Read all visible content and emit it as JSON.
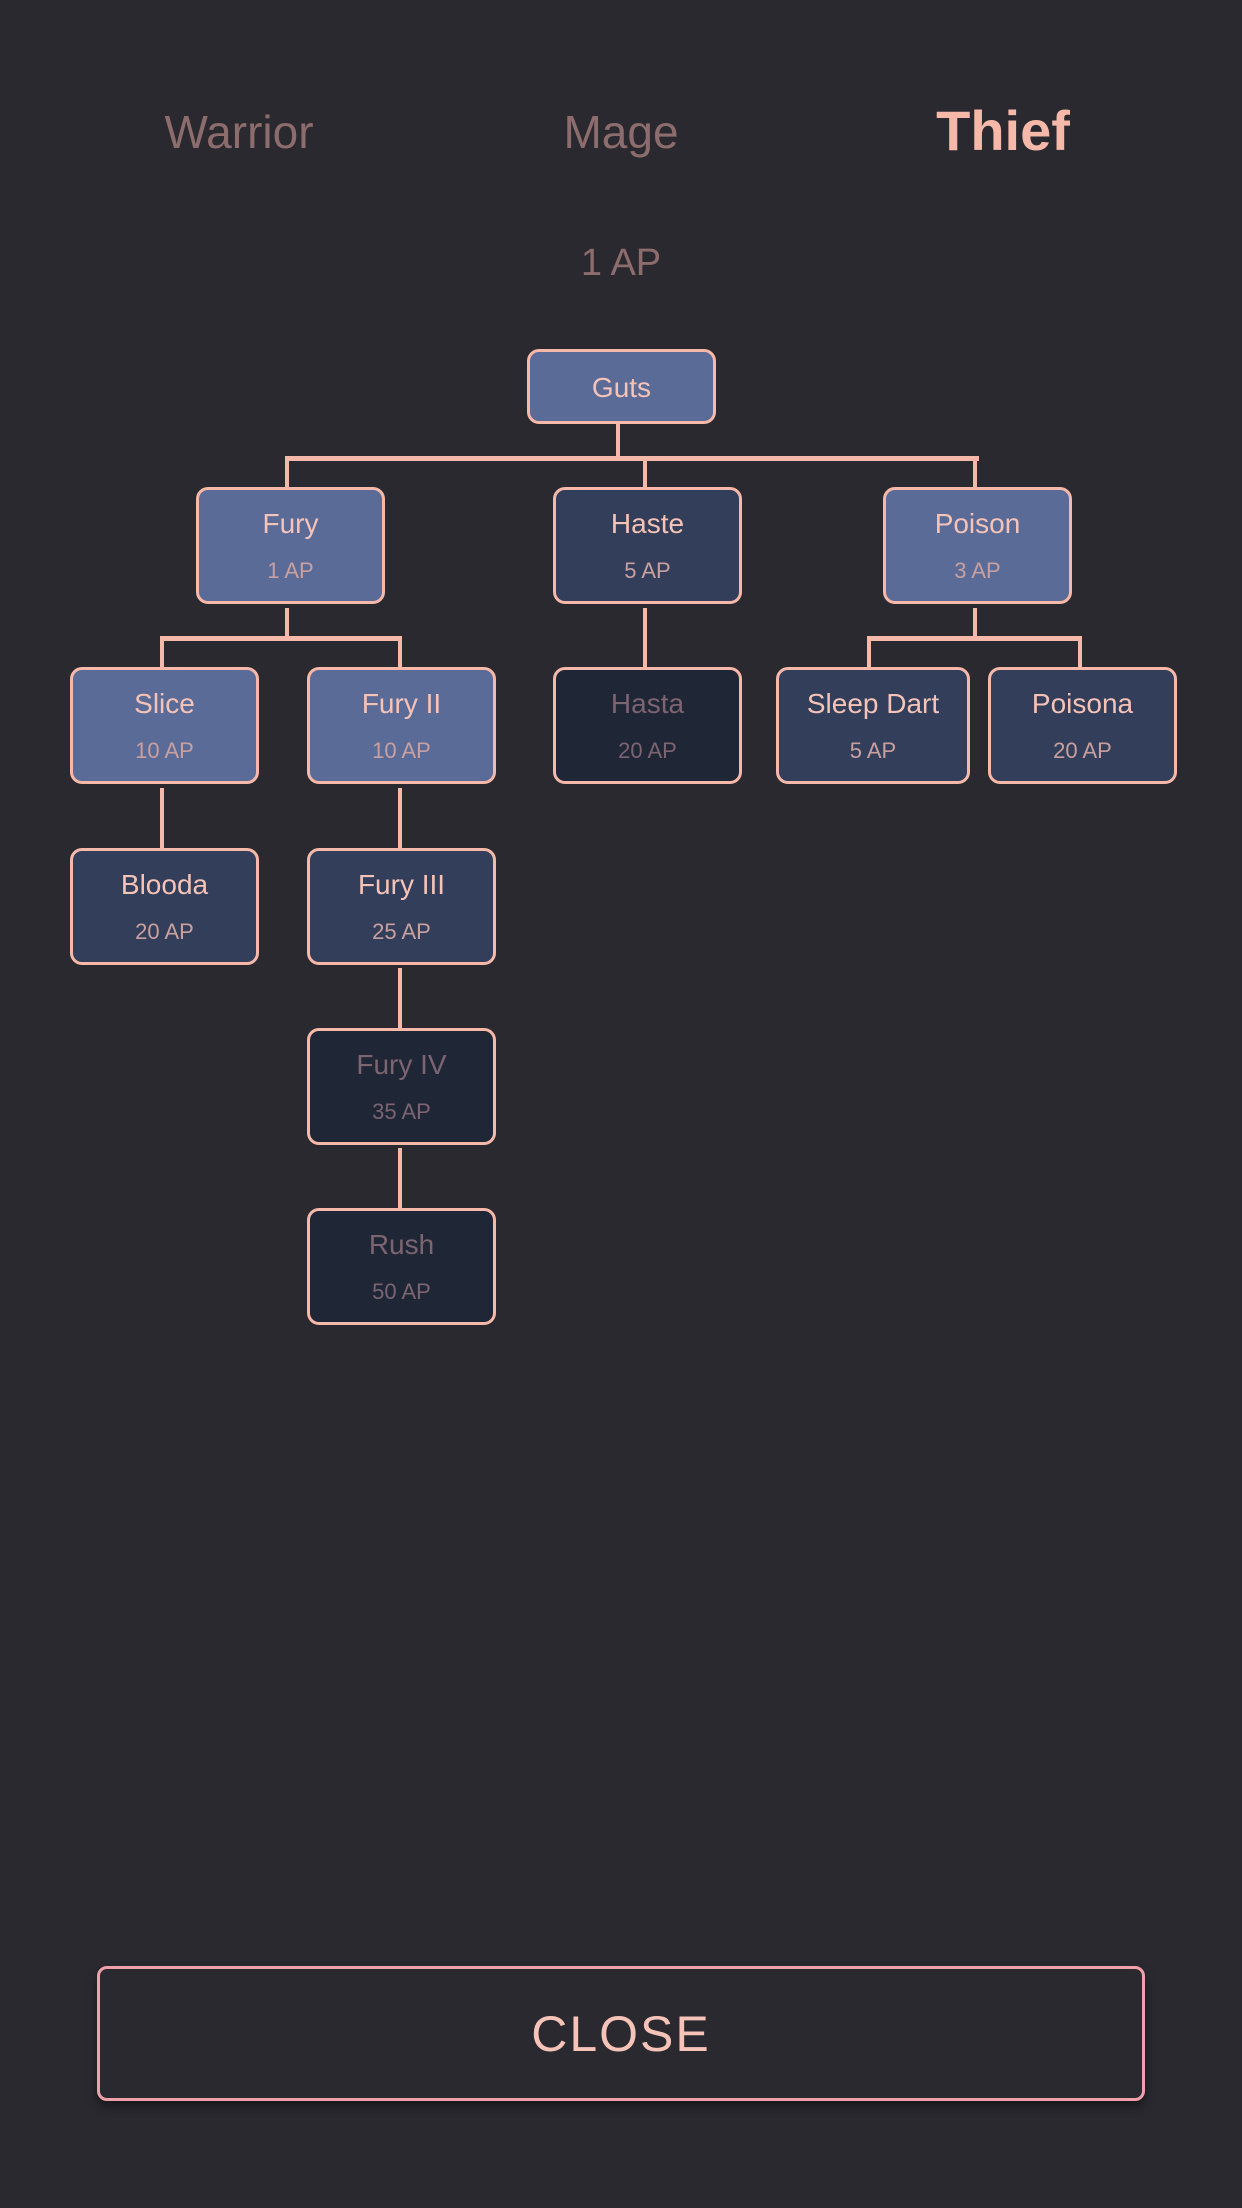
{
  "tabs": [
    {
      "label": "Warrior",
      "active": false
    },
    {
      "label": "Mage",
      "active": false
    },
    {
      "label": "Thief",
      "active": true
    }
  ],
  "ap_available": "1 AP",
  "colors": {
    "background": "#29292f",
    "connector": "#f6b8a8",
    "unlocked": "#5a6b98",
    "available": "#323e5a",
    "locked": "#1f2636"
  },
  "skills": {
    "guts": {
      "name": "Guts",
      "state": "unlocked"
    },
    "fury": {
      "name": "Fury",
      "cost": "1 AP",
      "state": "unlocked"
    },
    "haste": {
      "name": "Haste",
      "cost": "5 AP",
      "state": "available"
    },
    "poison": {
      "name": "Poison",
      "cost": "3 AP",
      "state": "unlocked"
    },
    "slice": {
      "name": "Slice",
      "cost": "10 AP",
      "state": "unlocked"
    },
    "fury2": {
      "name": "Fury II",
      "cost": "10 AP",
      "state": "unlocked"
    },
    "hasta": {
      "name": "Hasta",
      "cost": "20 AP",
      "state": "locked"
    },
    "sleep_dart": {
      "name": "Sleep Dart",
      "cost": "5 AP",
      "state": "available"
    },
    "poisona": {
      "name": "Poisona",
      "cost": "20 AP",
      "state": "available"
    },
    "blooda": {
      "name": "Blooda",
      "cost": "20 AP",
      "state": "available"
    },
    "fury3": {
      "name": "Fury III",
      "cost": "25 AP",
      "state": "available"
    },
    "fury4": {
      "name": "Fury IV",
      "cost": "35 AP",
      "state": "locked"
    },
    "rush": {
      "name": "Rush",
      "cost": "50 AP",
      "state": "locked"
    }
  },
  "close_label": "CLOSE"
}
